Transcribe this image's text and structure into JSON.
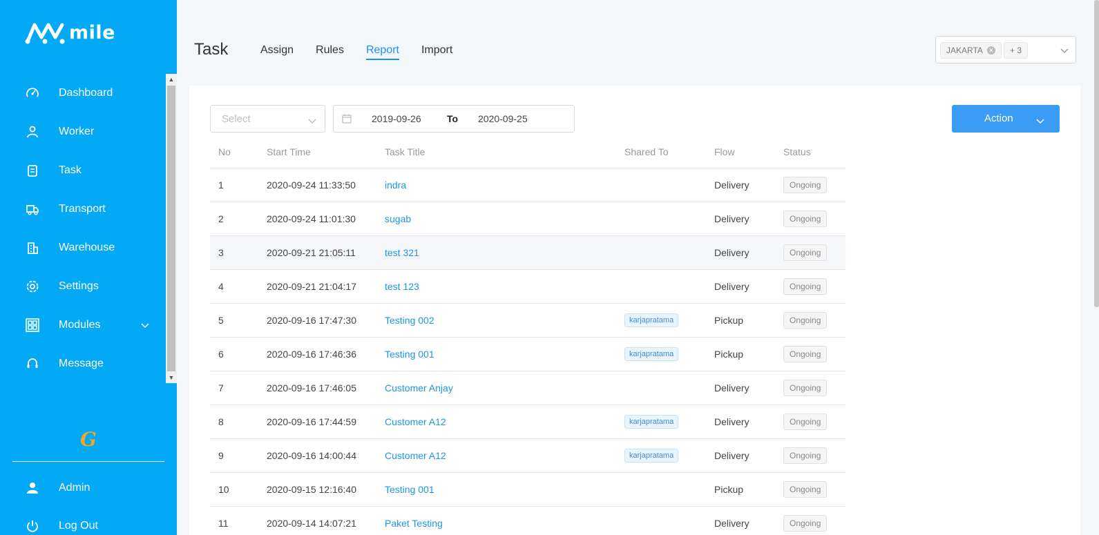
{
  "app": {
    "name": "mile"
  },
  "sidebar": {
    "items": [
      {
        "label": "Dashboard",
        "icon": "dashboard-icon"
      },
      {
        "label": "Worker",
        "icon": "worker-icon"
      },
      {
        "label": "Task",
        "icon": "task-icon"
      },
      {
        "label": "Transport",
        "icon": "truck-icon"
      },
      {
        "label": "Warehouse",
        "icon": "warehouse-icon"
      },
      {
        "label": "Settings",
        "icon": "gear-icon"
      },
      {
        "label": "Modules",
        "icon": "modules-icon",
        "has_submenu": true
      },
      {
        "label": "Message",
        "icon": "headset-icon"
      }
    ],
    "brand_mark": "G",
    "admin_label": "Admin",
    "logout_label": "Log Out"
  },
  "header": {
    "title": "Task",
    "tabs": [
      {
        "label": "Assign",
        "active": false
      },
      {
        "label": "Rules",
        "active": false
      },
      {
        "label": "Report",
        "active": true
      },
      {
        "label": "Import",
        "active": false
      }
    ],
    "region_filter": {
      "tag": "JAKARTA",
      "more": "+ 3"
    }
  },
  "filters": {
    "select_placeholder": "Select",
    "date_start": "2019-09-26",
    "date_separator": "To",
    "date_end": "2020-09-25",
    "action_label": "Action"
  },
  "table": {
    "columns": [
      "No",
      "Start Time",
      "Task Title",
      "Shared To",
      "Flow",
      "Status"
    ],
    "rows": [
      {
        "no": "1",
        "start": "2020-09-24 11:33:50",
        "title": "indra",
        "shared": "",
        "flow": "Delivery",
        "status": "Ongoing"
      },
      {
        "no": "2",
        "start": "2020-09-24 11:01:30",
        "title": "sugab",
        "shared": "",
        "flow": "Delivery",
        "status": "Ongoing"
      },
      {
        "no": "3",
        "start": "2020-09-21 21:05:11",
        "title": "test 321",
        "shared": "",
        "flow": "Delivery",
        "status": "Ongoing"
      },
      {
        "no": "4",
        "start": "2020-09-21 21:04:17",
        "title": "test 123",
        "shared": "",
        "flow": "Delivery",
        "status": "Ongoing"
      },
      {
        "no": "5",
        "start": "2020-09-16 17:47:30",
        "title": "Testing 002",
        "shared": "karjapratama",
        "flow": "Pickup",
        "status": "Ongoing"
      },
      {
        "no": "6",
        "start": "2020-09-16 17:46:36",
        "title": "Testing 001",
        "shared": "karjapratama",
        "flow": "Pickup",
        "status": "Ongoing"
      },
      {
        "no": "7",
        "start": "2020-09-16 17:46:05",
        "title": "Customer Anjay",
        "shared": "",
        "flow": "Delivery",
        "status": "Ongoing"
      },
      {
        "no": "8",
        "start": "2020-09-16 17:44:59",
        "title": "Customer A12",
        "shared": "karjapratama",
        "flow": "Delivery",
        "status": "Ongoing"
      },
      {
        "no": "9",
        "start": "2020-09-16 14:00:44",
        "title": "Customer A12",
        "shared": "karjapratama",
        "flow": "Delivery",
        "status": "Ongoing"
      },
      {
        "no": "10",
        "start": "2020-09-15 12:16:40",
        "title": "Testing 001",
        "shared": "",
        "flow": "Pickup",
        "status": "Ongoing"
      },
      {
        "no": "11",
        "start": "2020-09-14 14:07:21",
        "title": "Paket Testing",
        "shared": "",
        "flow": "Delivery",
        "status": "Ongoing"
      }
    ],
    "highlighted_row": 3
  },
  "colors": {
    "sidebar_bg": "#03a9f4",
    "accent": "#1890ff",
    "action_button": "#3a9cf4",
    "link": "#1e96e5",
    "brand_mark": "#f5a623"
  }
}
